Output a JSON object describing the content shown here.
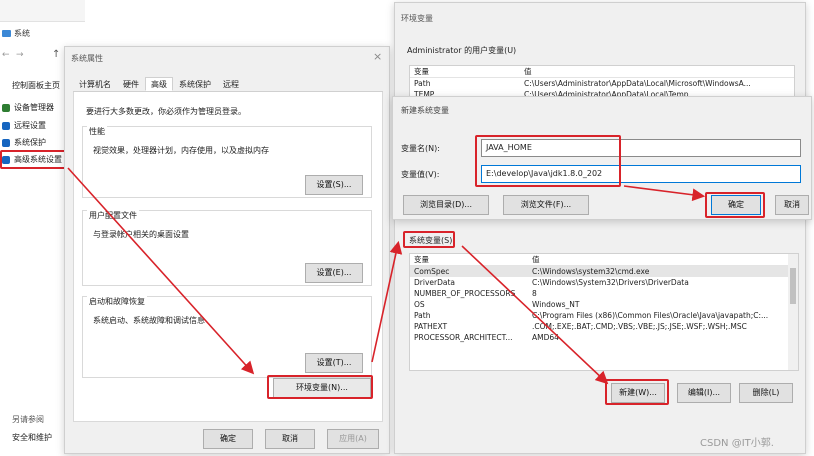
{
  "control_panel": {
    "title": "系统",
    "nav_home": "控制面板主页",
    "items": [
      {
        "label": "设备管理器",
        "color": "#2e7d32"
      },
      {
        "label": "远程设置",
        "color": "#1565c0"
      },
      {
        "label": "系统保护",
        "color": "#1565c0"
      },
      {
        "label": "高级系统设置",
        "color": "#1565c0"
      }
    ],
    "see_also": "另请参阅",
    "security": "安全和维护"
  },
  "sys_props": {
    "title": "系统属性",
    "tabs": [
      "计算机名",
      "硬件",
      "高级",
      "系统保护",
      "远程"
    ],
    "active_tab": 2,
    "note": "要进行大多数更改，你必须作为管理员登录。",
    "perf": {
      "title": "性能",
      "desc": "视觉效果，处理器计划，内存使用，以及虚拟内存",
      "button": "设置(S)..."
    },
    "profile": {
      "title": "用户配置文件",
      "desc": "与登录帐户相关的桌面设置",
      "button": "设置(E)..."
    },
    "startup": {
      "title": "启动和故障恢复",
      "desc": "系统启动、系统故障和调试信息",
      "button": "设置(T)..."
    },
    "env_button": "环境变量(N)...",
    "ok": "确定",
    "cancel": "取消",
    "apply": "应用(A)"
  },
  "env_vars": {
    "title": "环境变量",
    "user_section": "Administrator 的用户变量(U)",
    "col_var": "变量",
    "col_val": "值",
    "user_rows": [
      {
        "name": "变量",
        "value": "值"
      },
      {
        "name": "Path",
        "value": "C:\\Users\\Administrator\\AppData\\Local\\Microsoft\\WindowsA..."
      },
      {
        "name": "TEMP",
        "value": "C:\\Users\\Administrator\\AppData\\Local\\Temp"
      }
    ],
    "sys_section": "系统变量(S)",
    "sys_rows": [
      {
        "name": "ComSpec",
        "value": "C:\\Windows\\system32\\cmd.exe"
      },
      {
        "name": "DriverData",
        "value": "C:\\Windows\\System32\\Drivers\\DriverData"
      },
      {
        "name": "NUMBER_OF_PROCESSORS",
        "value": "8"
      },
      {
        "name": "OS",
        "value": "Windows_NT"
      },
      {
        "name": "Path",
        "value": "C:\\Program Files (x86)\\Common Files\\Oracle\\Java\\javapath;C:..."
      },
      {
        "name": "PATHEXT",
        "value": ".COM;.EXE;.BAT;.CMD;.VBS;.VBE;.JS;.JSE;.WSF;.WSH;.MSC"
      },
      {
        "name": "PROCESSOR_ARCHITECT...",
        "value": "AMD64"
      }
    ],
    "new_button": "新建(W)...",
    "edit_button": "编辑(I)...",
    "delete_button": "删除(L)"
  },
  "new_var": {
    "title": "新建系统变量",
    "name_label": "变量名(N):",
    "name_value": "JAVA_HOME",
    "value_label": "变量值(V):",
    "value_value": "E:\\develop\\Java\\jdk1.8.0_202",
    "browse_dir": "浏览目录(D)...",
    "browse_file": "浏览文件(F)...",
    "ok": "确定",
    "cancel": "取消"
  },
  "watermark": "CSDN @IT小郭.",
  "accent_red": "#d8232a"
}
